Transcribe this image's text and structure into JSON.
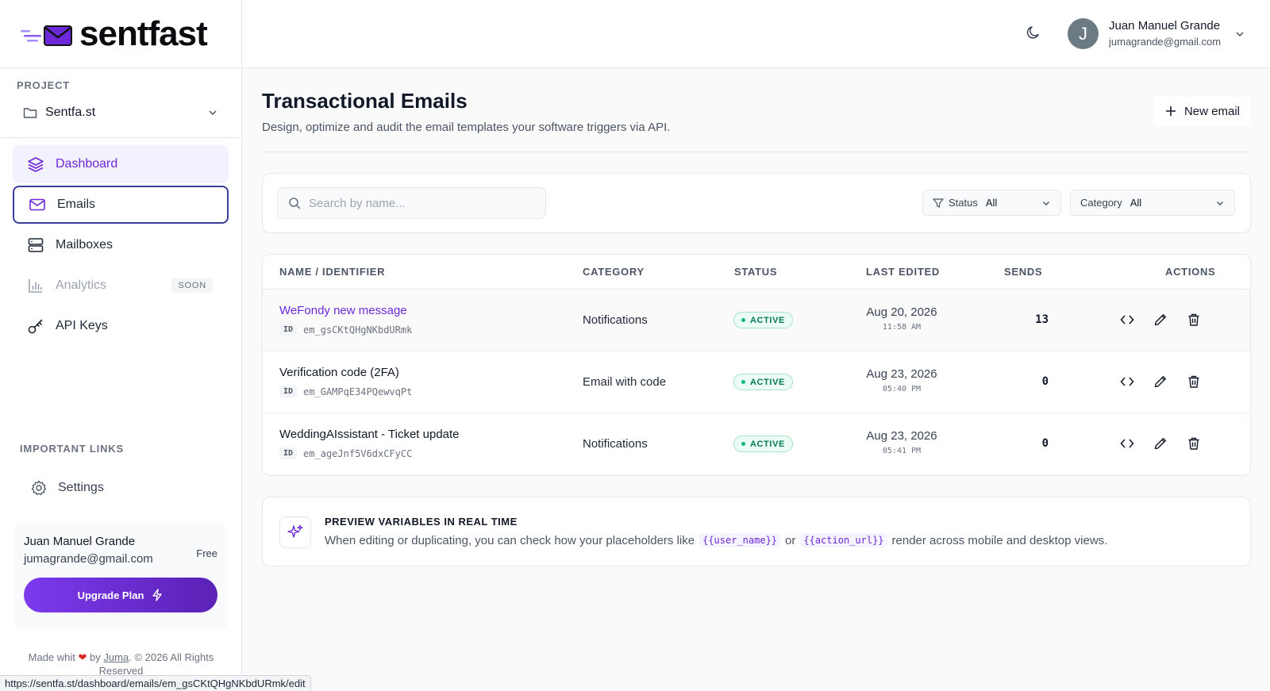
{
  "app": {
    "brand": "sentfast"
  },
  "sidebar": {
    "project_label": "PROJECT",
    "project_name": "Sentfa.st",
    "items": [
      {
        "label": "Dashboard",
        "icon": "layers-icon"
      },
      {
        "label": "Emails",
        "icon": "mail-icon"
      },
      {
        "label": "Mailboxes",
        "icon": "server-icon"
      },
      {
        "label": "Analytics",
        "icon": "bar-chart-icon",
        "badge": "SOON"
      },
      {
        "label": "API Keys",
        "icon": "key-icon"
      }
    ],
    "links_label": "IMPORTANT LINKS",
    "settings_label": "Settings",
    "user_card": {
      "name": "Juan Manuel Grande",
      "email": "jumagrande@gmail.com",
      "plan": "Free",
      "upgrade_label": "Upgrade Plan"
    },
    "footer": {
      "prefix": "Made whit",
      "by": "by",
      "author": "Juma",
      "suffix": ". © 2026 All Rights Reserved"
    },
    "status_url": "https://sentfa.st/dashboard/emails/em_gsCKtQHgNKbdURmk/edit"
  },
  "topbar": {
    "user_initial": "J",
    "user_name": "Juan Manuel Grande",
    "user_email": "jumagrande@gmail.com"
  },
  "page": {
    "title": "Transactional Emails",
    "subtitle": "Design, optimize and audit the email templates your software triggers via API.",
    "new_button": "New email"
  },
  "filters": {
    "search_placeholder": "Search by name...",
    "status_label": "Status",
    "status_value": "All",
    "category_label": "Category",
    "category_value": "All"
  },
  "table": {
    "columns": [
      "NAME / IDENTIFIER",
      "CATEGORY",
      "STATUS",
      "LAST EDITED",
      "SENDS",
      "ACTIONS"
    ],
    "id_tag": "ID",
    "rows": [
      {
        "name": "WeFondy new message",
        "id": "em_gsCKtQHgNKbdURmk",
        "category": "Notifications",
        "status": "ACTIVE",
        "date": "Aug 20, 2026",
        "time": "11:58 AM",
        "sends": "13"
      },
      {
        "name": "Verification code (2FA)",
        "id": "em_GAMPqE34PQewvqPt",
        "category": "Email with code",
        "status": "ACTIVE",
        "date": "Aug 23, 2026",
        "time": "05:40 PM",
        "sends": "0"
      },
      {
        "name": "WeddingAIssistant - Ticket update",
        "id": "em_ageJnf5V6dxCFyCC",
        "category": "Notifications",
        "status": "ACTIVE",
        "date": "Aug 23, 2026",
        "time": "05:41 PM",
        "sends": "0"
      }
    ]
  },
  "tip": {
    "title": "PREVIEW VARIABLES IN REAL TIME",
    "text_before": "When editing or duplicating, you can check how your placeholders like",
    "var1": "{{user_name}}",
    "text_mid": "or",
    "var2": "{{action_url}}",
    "text_after": "render across mobile and desktop views."
  },
  "colors": {
    "accent": "#6d28d9",
    "active_badge": "#047857",
    "upgrade_gradient_start": "#7c3aed"
  }
}
